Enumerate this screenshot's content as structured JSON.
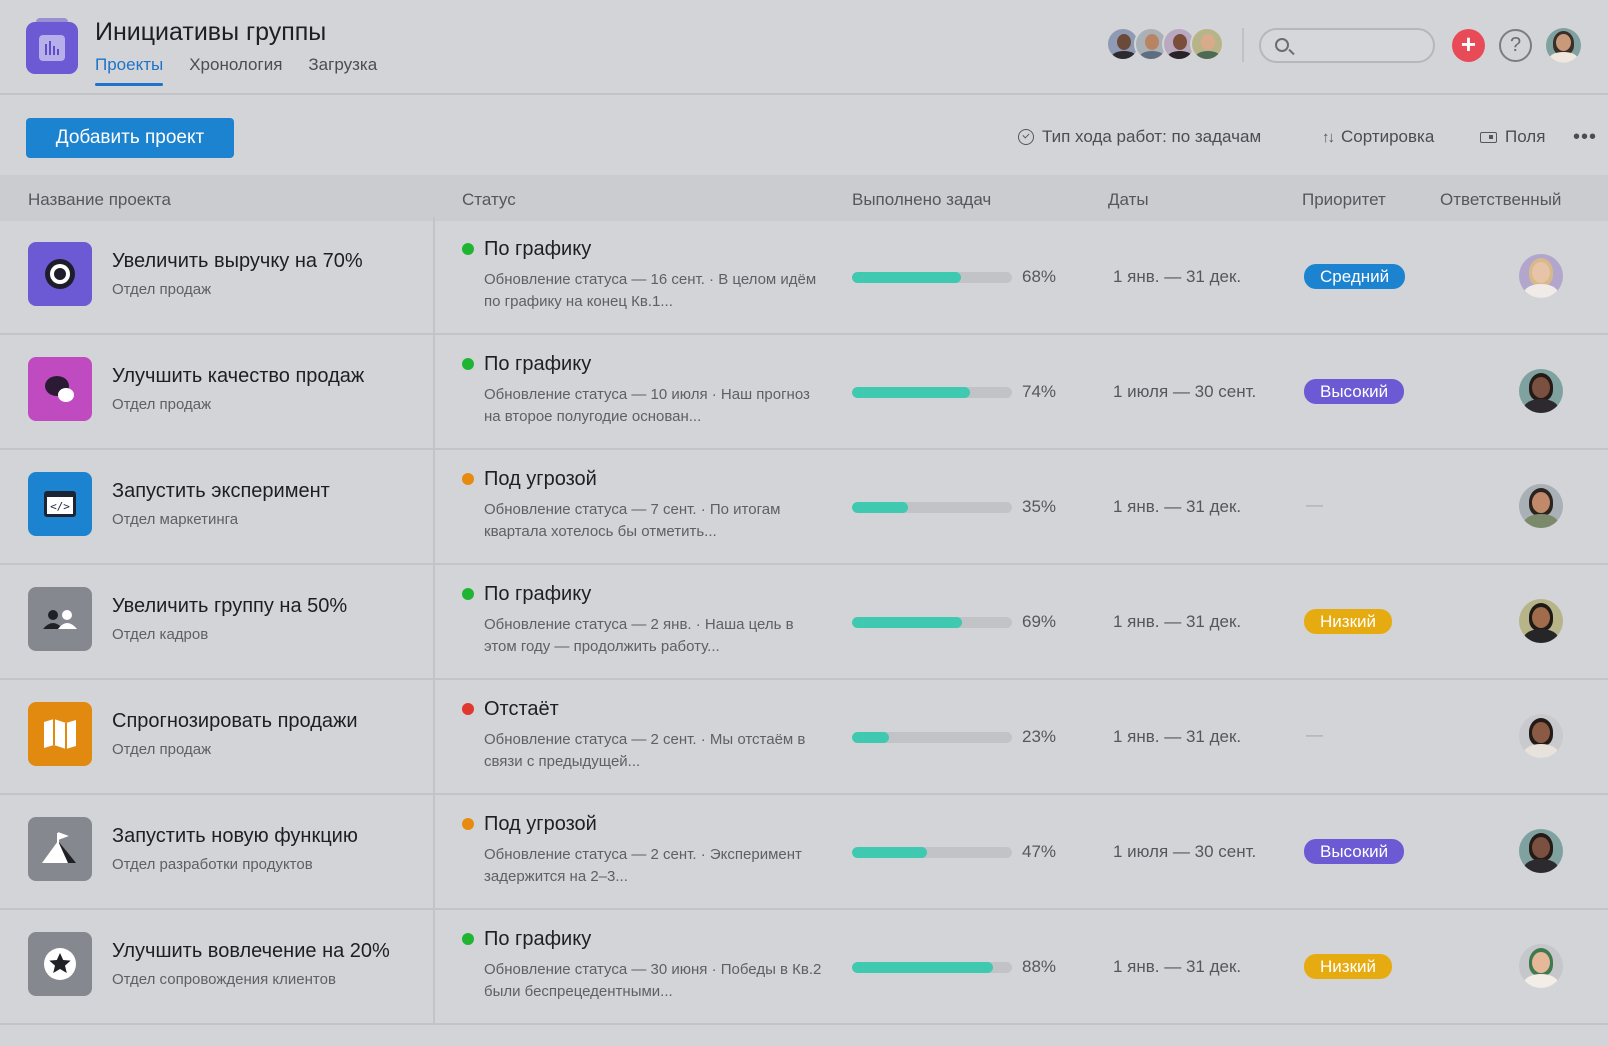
{
  "header": {
    "title": "Инициативы группы",
    "tabs": [
      {
        "label": "Проекты",
        "active": true
      },
      {
        "label": "Хронология",
        "active": false
      },
      {
        "label": "Загрузка",
        "active": false
      }
    ],
    "search": {
      "placeholder": ""
    },
    "plus_label": "+",
    "help_label": "?"
  },
  "toolbar": {
    "add_project_label": "Добавить проект",
    "progress_type_label": "Тип хода работ: по задачам",
    "sort_label": "Сортировка",
    "fields_label": "Поля",
    "more_label": "•••"
  },
  "columns": {
    "name": "Название проекта",
    "status": "Статус",
    "completed": "Выполнено задач",
    "dates": "Даты",
    "priority": "Приоритет",
    "owner": "Ответственный"
  },
  "colors": {
    "accent": "#1f73c9",
    "status_on_track": "#1fb533",
    "status_at_risk": "#e68a10",
    "status_off_track": "#e0372f",
    "progress_fill": "#3fc9b0",
    "priority_medium": "#1c83d0",
    "priority_high": "#6b5ad3",
    "priority_low": "#e6ab10"
  },
  "projects": [
    {
      "name": "Увеличить выручку на 70%",
      "department": "Отдел продаж",
      "icon": "target-icon",
      "icon_color": "#6b5ad3",
      "status": "По графику",
      "status_kind": "on_track",
      "status_note": "Обновление статуса — 16 сент. · В целом идём по графику на конец Кв.1...",
      "progress": 0.68,
      "progress_label": "68%",
      "dates": "1 янв. — 31 дек.",
      "priority": "Средний",
      "priority_kind": "medium"
    },
    {
      "name": "Улучшить качество продаж",
      "department": "Отдел продаж",
      "icon": "chat-bubbles-icon",
      "icon_color": "#c04bc0",
      "status": "По графику",
      "status_kind": "on_track",
      "status_note": "Обновление статуса — 10 июля · Наш прогноз на второе полугодие основан...",
      "progress": 0.74,
      "progress_label": "74%",
      "dates": "1 июля — 30 сент.",
      "priority": "Высокий",
      "priority_kind": "high"
    },
    {
      "name": "Запустить эксперимент",
      "department": "Отдел маркетинга",
      "icon": "code-window-icon",
      "icon_color": "#1c83d0",
      "status": "Под угрозой",
      "status_kind": "at_risk",
      "status_note": "Обновление статуса — 7 сент. · По итогам квартала хотелось бы отметить...",
      "progress": 0.35,
      "progress_label": "35%",
      "dates": "1 янв. — 31 дек.",
      "priority": "—",
      "priority_kind": "none"
    },
    {
      "name": "Увеличить группу на 50%",
      "department": "Отдел кадров",
      "icon": "people-icon",
      "icon_color": "#85888e",
      "status": "По графику",
      "status_kind": "on_track",
      "status_note": "Обновление статуса — 2 янв. · Наша цель в этом году — продолжить работу...",
      "progress": 0.69,
      "progress_label": "69%",
      "dates": "1 янв. — 31 дек.",
      "priority": "Низкий",
      "priority_kind": "low"
    },
    {
      "name": "Спрогнозировать продажи",
      "department": "Отдел продаж",
      "icon": "map-icon",
      "icon_color": "#e28a10",
      "status": "Отстаёт",
      "status_kind": "off_track",
      "status_note": "Обновление статуса — 2 сент. · Мы отстаём в связи с предыдущей...",
      "progress": 0.23,
      "progress_label": "23%",
      "dates": "1 янв. — 31 дек.",
      "priority": "—",
      "priority_kind": "none"
    },
    {
      "name": "Запустить новую функцию",
      "department": "Отдел разработки продуктов",
      "icon": "mountain-flag-icon",
      "icon_color": "#85888e",
      "status": "Под угрозой",
      "status_kind": "at_risk",
      "status_note": "Обновление статуса — 2 сент. · Эксперимент задержится на 2–3...",
      "progress": 0.47,
      "progress_label": "47%",
      "dates": "1 июля — 30 сент.",
      "priority": "Высокий",
      "priority_kind": "high"
    },
    {
      "name": "Улучшить вовлечение на 20%",
      "department": "Отдел сопровождения клиентов",
      "icon": "star-icon",
      "icon_color": "#85888e",
      "status": "По графику",
      "status_kind": "on_track",
      "status_note": "Обновление статуса — 30 июня · Победы в Кв.2 были беспрецедентными...",
      "progress": 0.88,
      "progress_label": "88%",
      "dates": "1 янв. — 31 дек.",
      "priority": "Низкий",
      "priority_kind": "low"
    }
  ]
}
